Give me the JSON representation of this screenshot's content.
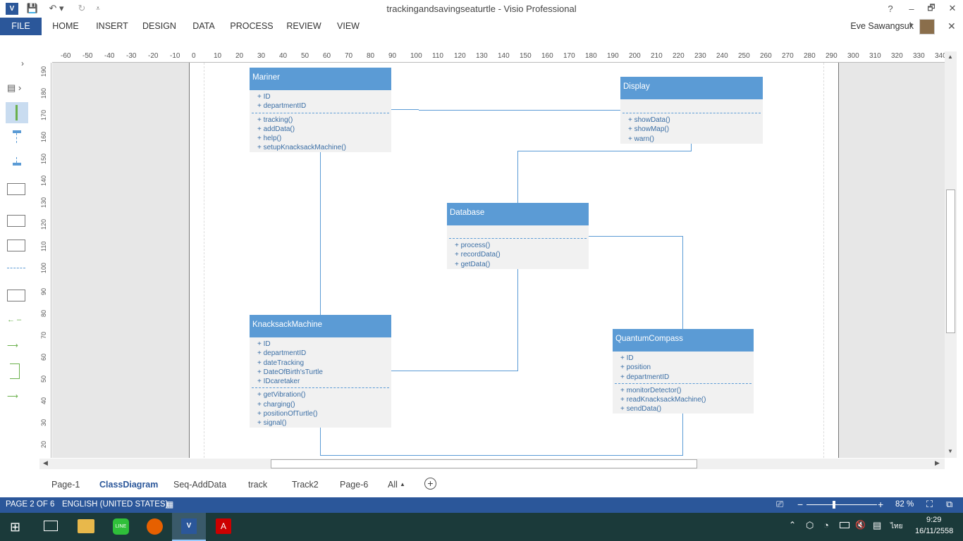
{
  "app": {
    "title": "trackingandsavingseaturtle - Visio Professional",
    "user": "Eve Sawangsuk"
  },
  "window_controls": {
    "help": "?",
    "minimize": "–",
    "restore": "🗗",
    "close": "✕"
  },
  "ribbon": {
    "file": "FILE",
    "tabs": [
      "HOME",
      "INSERT",
      "DESIGN",
      "DATA",
      "PROCESS",
      "REVIEW",
      "VIEW"
    ]
  },
  "ruler": {
    "top": [
      "-60",
      "-50",
      "-40",
      "-30",
      "-20",
      "-10",
      "0",
      "10",
      "20",
      "30",
      "40",
      "50",
      "60",
      "70",
      "80",
      "90",
      "100",
      "110",
      "120",
      "130",
      "140",
      "150",
      "160",
      "170",
      "180",
      "190",
      "200",
      "210",
      "220",
      "230",
      "240",
      "250",
      "260",
      "270",
      "280",
      "290",
      "300",
      "310",
      "320",
      "330",
      "340"
    ],
    "left": [
      "190",
      "180",
      "170",
      "160",
      "150",
      "140",
      "130",
      "120",
      "110",
      "100",
      "90",
      "80",
      "70",
      "60",
      "50",
      "40",
      "30",
      "20"
    ]
  },
  "classes": {
    "mariner": {
      "name": "Mariner",
      "attributes": [
        "+ ID",
        "+ departmentID"
      ],
      "methods": [
        "+ tracking()",
        "+ addData()",
        "+ help()",
        "+ setupKnacksackMachine()"
      ]
    },
    "display": {
      "name": "Display",
      "attributes": [],
      "methods": [
        "+ showData()",
        "+ showMap()",
        "+ warn()"
      ]
    },
    "database": {
      "name": "Database",
      "attributes": [],
      "methods": [
        "+ process()",
        "+ recordData()",
        "+ getData()"
      ]
    },
    "knacksack": {
      "name": "KnacksackMachine",
      "attributes": [
        "+ ID",
        "+ departmentID",
        "+ dateTracking",
        "+ DateOfBirth'sTurtle",
        "+ IDcaretaker"
      ],
      "methods": [
        "+ getVibration()",
        "+ charging()",
        "+ positionOfTurtle()",
        "+ signal()"
      ]
    },
    "quantum": {
      "name": "QuantumCompass",
      "attributes": [
        "+ ID",
        "+ position",
        "+ departmentID"
      ],
      "methods": [
        "+ monitorDetector()",
        "+ readKnacksackMachine()",
        "+ sendData()"
      ]
    }
  },
  "page_tabs": {
    "items": [
      "Page-1",
      "ClassDiagram",
      "Seq-AddData",
      "track",
      "Track2",
      "Page-6"
    ],
    "active": "ClassDiagram",
    "all": "All"
  },
  "status": {
    "page": "PAGE 2 OF 6",
    "language": "ENGLISH (UNITED STATES)",
    "zoom": "82 %"
  },
  "taskbar": {
    "lang": "ไทย",
    "time": "9:29",
    "date": "16/11/2558"
  },
  "colors": {
    "accent": "#2b579a",
    "shape_header": "#5b9bd5",
    "shape_text": "#3a6ea5"
  }
}
